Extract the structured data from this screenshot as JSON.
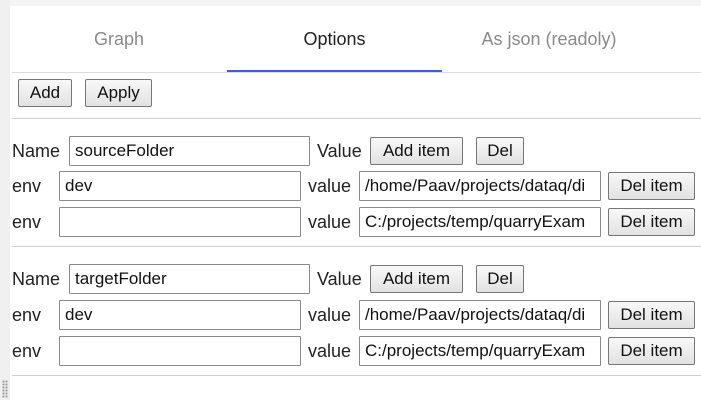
{
  "tabs": [
    {
      "label": "Graph",
      "active": false
    },
    {
      "label": "Options",
      "active": true
    },
    {
      "label": "As json (readoly)",
      "active": false
    }
  ],
  "toolbar": {
    "add_label": "Add",
    "apply_label": "Apply"
  },
  "labels": {
    "name": "Name",
    "value_header": "Value",
    "env": "env",
    "value": "value",
    "add_item": "Add item",
    "del": "Del",
    "del_item": "Del item"
  },
  "options": [
    {
      "name": "sourceFolder",
      "items": [
        {
          "env": "dev",
          "value": "/home/Paav/projects/dataq/di"
        },
        {
          "env": "",
          "value": "C:/projects/temp/quarryExam"
        }
      ]
    },
    {
      "name": "targetFolder",
      "items": [
        {
          "env": "dev",
          "value": "/home/Paav/projects/dataq/di"
        },
        {
          "env": "",
          "value": "C:/projects/temp/quarryExam"
        }
      ]
    }
  ],
  "colors": {
    "tab_indicator": "#3b64c4",
    "inactive_tab_text": "#8a8a8a"
  }
}
